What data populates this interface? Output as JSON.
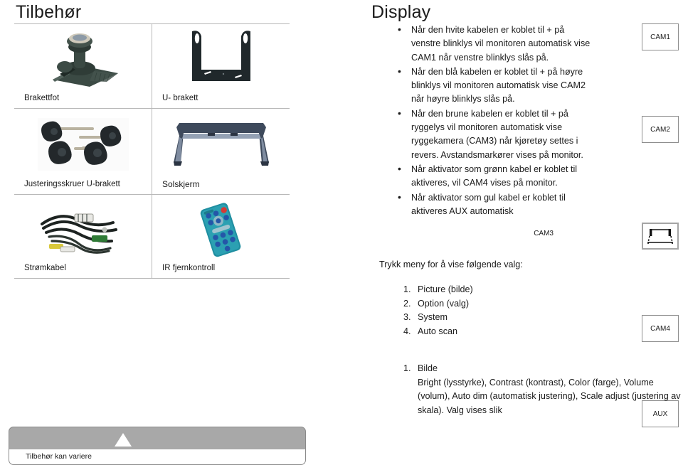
{
  "titles": {
    "accessories": "Tilbehør",
    "display": "Display"
  },
  "accessories_table": {
    "items": [
      {
        "label": "Brakettfot",
        "art": "bracket-foot"
      },
      {
        "label": "U- brakett",
        "art": "u-bracket"
      },
      {
        "label": "Justeringsskruer U-brakett",
        "art": "adjustment-screws"
      },
      {
        "label": "Solskjerm",
        "art": "sun-visor"
      },
      {
        "label": "Strømkabel",
        "art": "power-cable"
      },
      {
        "label": "IR fjernkontroll",
        "art": "ir-remote"
      }
    ]
  },
  "display": {
    "bullets": [
      "Når den hvite kabelen er koblet til + på venstre blinklys vil monitoren automatisk vise CAM1 når venstre blinklys slås på.",
      "Når den blå kabelen er koblet til + på høyre blinklys vil monitoren automatisk vise CAM2 når høyre blinklys slås på.",
      "Når den brune kabelen er koblet til + på ryggelys vil monitoren automatisk vise ryggekamera (CAM3) når kjøretøy settes i revers. Avstandsmarkører vises på monitor.",
      "Når aktivator som grønn kabel er koblet til aktiveres, vil CAM4 vises på monitor.",
      "Når aktivator som gul kabel er koblet til aktiveres AUX automatisk"
    ],
    "cam_boxes": [
      {
        "label": "CAM1",
        "side_label": "",
        "icon": ""
      },
      {
        "label": "CAM2",
        "side_label": "",
        "icon": ""
      },
      {
        "label": "",
        "side_label": "CAM3",
        "icon": "parking-guidelines-icon"
      },
      {
        "label": "CAM4",
        "side_label": "",
        "icon": ""
      },
      {
        "label": "AUX",
        "side_label": "",
        "icon": ""
      }
    ]
  },
  "menu": {
    "intro": "Trykk meny for å vise følgende valg:",
    "options": [
      "Picture (bilde)",
      "Option (valg)",
      "System",
      "Auto scan"
    ],
    "detail": {
      "heading": "Bilde",
      "body": "Bright (lysstyrke), Contrast (kontrast), Color (farge), Volume (volum), Auto dim (automatisk justering), Scale adjust (justering av skala). Valg vises slik"
    }
  },
  "footer": {
    "note": "Tilbehør kan variere"
  },
  "colors": {
    "table_border": "#b8b8b8",
    "device_bar": "#a8a8a8",
    "text": "#1b1b1b"
  }
}
